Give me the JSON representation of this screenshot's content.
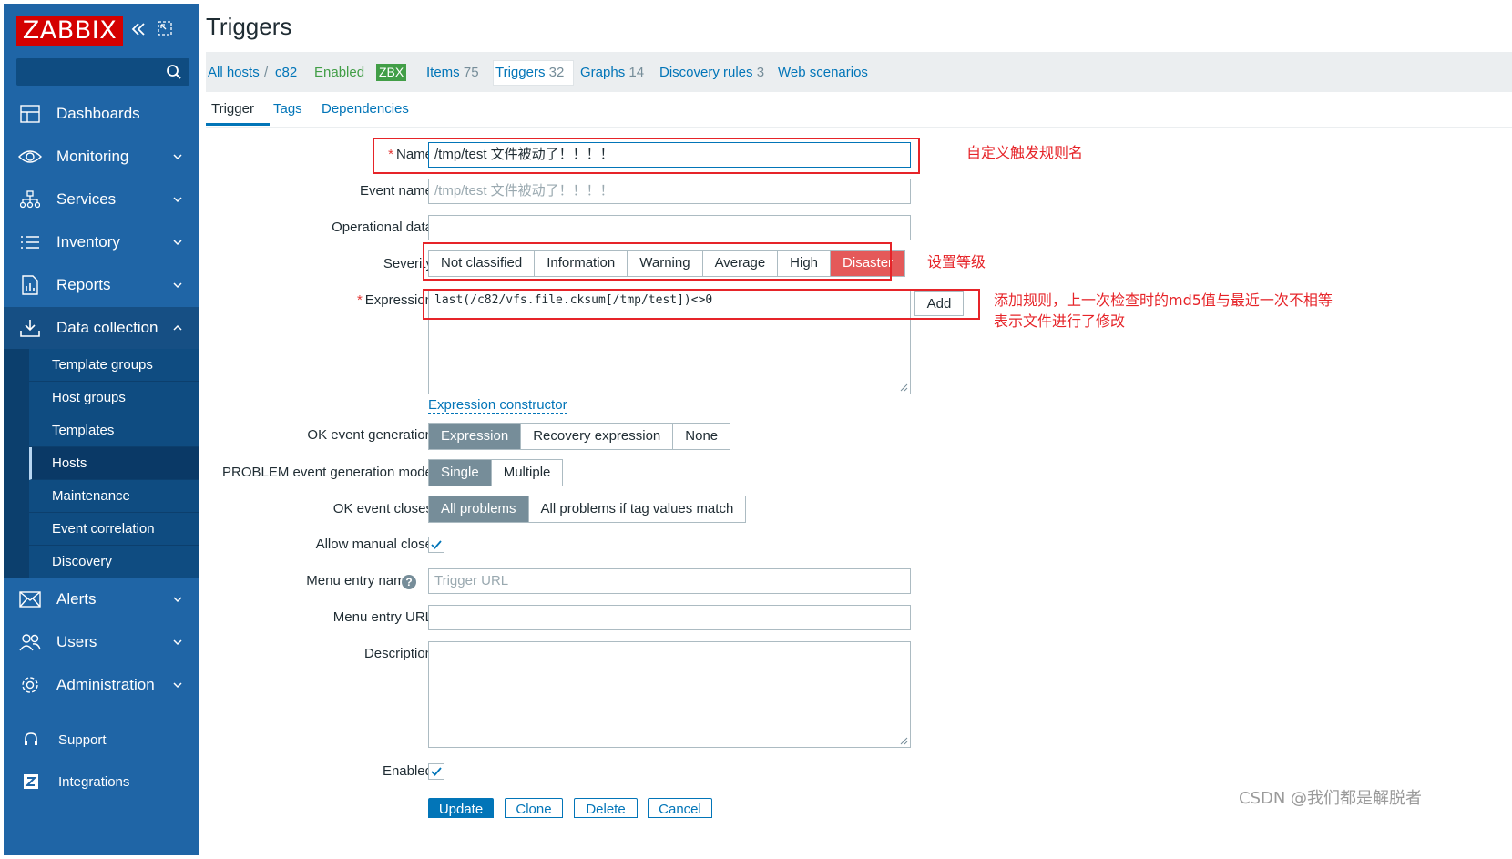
{
  "sidebar": {
    "logo": "ZABBIX",
    "collapse_icon": "chevrons-left-icon",
    "kiosk_icon": "expand-icon",
    "search_icon": "search-icon",
    "menu": [
      {
        "label": "Dashboards",
        "icon": "dashboard-icon"
      },
      {
        "label": "Monitoring",
        "icon": "eye-icon"
      },
      {
        "label": "Services",
        "icon": "services-icon"
      },
      {
        "label": "Inventory",
        "icon": "list-icon"
      },
      {
        "label": "Reports",
        "icon": "report-icon"
      },
      {
        "label": "Data collection",
        "icon": "download-icon"
      },
      {
        "label": "Alerts",
        "icon": "envelope-icon"
      },
      {
        "label": "Users",
        "icon": "users-icon"
      },
      {
        "label": "Administration",
        "icon": "gear-icon"
      }
    ],
    "submenu": [
      "Template groups",
      "Host groups",
      "Templates",
      "Hosts",
      "Maintenance",
      "Event correlation",
      "Discovery"
    ],
    "support": "Support",
    "integrations": "Integrations"
  },
  "header": {
    "title": "Triggers"
  },
  "hostnav": {
    "all_hosts": "All hosts",
    "separator": "/",
    "host": "c82",
    "enabled": "Enabled",
    "zbx": "ZBX",
    "items": "Items",
    "items_count": "75",
    "triggers": "Triggers",
    "triggers_count": "32",
    "graphs": "Graphs",
    "graphs_count": "14",
    "discovery": "Discovery rules",
    "discovery_count": "3",
    "web": "Web scenarios"
  },
  "tabs": [
    "Trigger",
    "Tags",
    "Dependencies"
  ],
  "form": {
    "name_label": "Name",
    "name_value": "/tmp/test 文件被动了！！！！",
    "event_name_label": "Event name",
    "event_name_placeholder": "/tmp/test 文件被动了！！！！",
    "opdata_label": "Operational data",
    "severity_label": "Severity",
    "severity_options": [
      "Not classified",
      "Information",
      "Warning",
      "Average",
      "High",
      "Disaster"
    ],
    "severity_selected": "Disaster",
    "expression_label": "Expression",
    "expression_value": "last(/c82/vfs.file.cksum[/tmp/test])<>0",
    "add_label": "Add",
    "expr_constructor": "Expression constructor",
    "ok_event_gen_label": "OK event generation",
    "ok_event_gen_options": [
      "Expression",
      "Recovery expression",
      "None"
    ],
    "problem_mode_label": "PROBLEM event generation mode",
    "problem_mode_options": [
      "Single",
      "Multiple"
    ],
    "ok_closes_label": "OK event closes",
    "ok_closes_options": [
      "All problems",
      "All problems if tag values match"
    ],
    "manual_close_label": "Allow manual close",
    "menu_entry_name_label": "Menu entry name",
    "menu_entry_name_placeholder": "Trigger URL",
    "menu_entry_url_label": "Menu entry URL",
    "description_label": "Description",
    "enabled_label": "Enabled",
    "help": "?"
  },
  "buttons": {
    "update": "Update",
    "clone": "Clone",
    "delete": "Delete",
    "cancel": "Cancel"
  },
  "annotations": {
    "name_note": "自定义触发规则名",
    "severity_note": "设置等级",
    "expr_note_line1": "添加规则，上一次检查时的md5值与最近一次不相等",
    "expr_note_line2": "表示文件进行了修改"
  },
  "watermark": "CSDN @我们都是解脱者",
  "colors": {
    "sidebar": "#1f65a6",
    "accent": "#0275b8",
    "disaster": "#e45959",
    "selected": "#768d99",
    "annotation": "#e62429",
    "logo": "#d40000"
  }
}
